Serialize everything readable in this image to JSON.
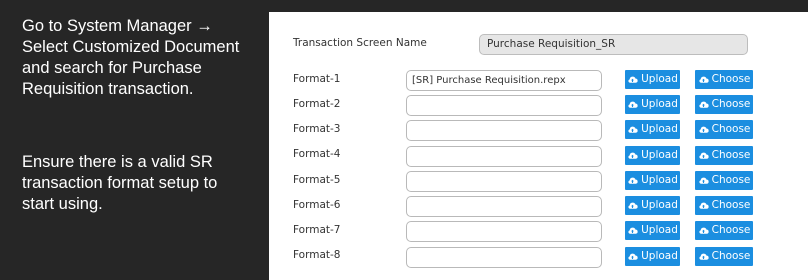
{
  "instructions": {
    "paragraph_1": "Go to System Manager → Select Customized Document and search for Purchase Requisition transaction.",
    "paragraph_2": "Ensure there is a valid SR transaction format setup to start using."
  },
  "form": {
    "screen_name_label": "Transaction Screen Name",
    "screen_name_value": "Purchase Requisition_SR",
    "upload_label": "Upload",
    "choose_label": "Choose",
    "upload_icon": "cloud-upload-icon",
    "choose_icon": "cloud-upload-icon",
    "button_color": "#1b8ee0",
    "formats": [
      {
        "label": "Format-1",
        "value": "[SR] Purchase Requisition.repx"
      },
      {
        "label": "Format-2",
        "value": ""
      },
      {
        "label": "Format-3",
        "value": ""
      },
      {
        "label": "Format-4",
        "value": ""
      },
      {
        "label": "Format-5",
        "value": ""
      },
      {
        "label": "Format-6",
        "value": ""
      },
      {
        "label": "Format-7",
        "value": ""
      },
      {
        "label": "Format-8",
        "value": ""
      }
    ]
  }
}
